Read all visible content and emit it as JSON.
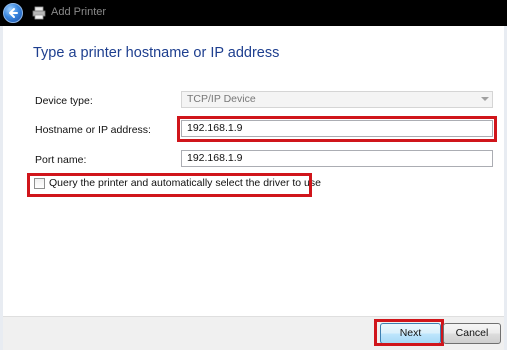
{
  "window": {
    "title": "Add Printer",
    "heading": "Type a printer hostname or IP address"
  },
  "form": {
    "device_type": {
      "label": "Device type:",
      "value": "TCP/IP Device"
    },
    "hostname": {
      "label": "Hostname or IP address:",
      "value": "192.168.1.9"
    },
    "port_name": {
      "label": "Port name:",
      "value": "192.168.1.9"
    },
    "query_printer": {
      "label": "Query the printer and automatically select the driver to use",
      "checked": false
    }
  },
  "footer": {
    "next_label": "Next",
    "cancel_label": "Cancel"
  },
  "colors": {
    "heading": "#1e3f8f",
    "highlight": "#d0151b"
  }
}
